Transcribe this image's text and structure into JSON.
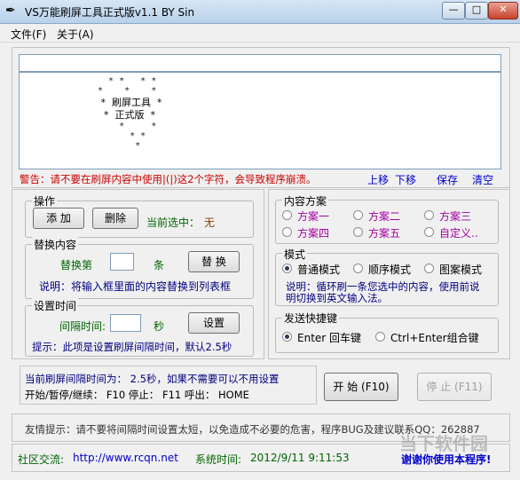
{
  "window": {
    "title": "VS万能刷屏工具正式版v1.1    BY Sin",
    "app_icon": "feather-icon",
    "min_label": "—",
    "max_label": "□",
    "close_label": "✕"
  },
  "menu": {
    "file": "文件(F)",
    "about": "关于(A)"
  },
  "preview": {
    "line1": "  * *   * *",
    "line2": "*    *    *",
    "line3": " *  刷屏工具  *",
    "line4": "  *  正式版  *",
    "line5": "    *     *",
    "line6": "      * *",
    "line7": "       *"
  },
  "warning": "警告：请不要在刷屏内容中使用|(|)这2个字符，会导致程序崩溃。",
  "actions": {
    "up": "上移",
    "down": "下移",
    "save": "保存",
    "clear": "清空"
  },
  "ops": {
    "label": "操作",
    "add": "添 加",
    "delete": "删除",
    "current_selected_label": "当前选中：",
    "current_selected_value": "无"
  },
  "replace": {
    "label": "替换内容",
    "prefix": "替换第",
    "suffix": "条",
    "button": "替 换",
    "hint": "说明：将输入框里面的内容替换到列表框"
  },
  "interval": {
    "label": "设置时间",
    "prefix": "间隔时间:",
    "unit": "秒",
    "button": "设置",
    "hint": "提示：此项是设置刷屏间隔时间，默认2.5秒"
  },
  "content_plan": {
    "label": "内容方案",
    "options": [
      "方案一",
      "方案二",
      "方案三",
      "方案四",
      "方案五",
      "自定义.."
    ]
  },
  "mode": {
    "label": "模式",
    "options": [
      "普通模式",
      "顺序模式",
      "图案模式"
    ],
    "selected": 0,
    "hint": "说明：循环刷一条您选中的内容，使用前说明切换到英文输入法。"
  },
  "hotkey": {
    "label": "发送快捷键",
    "options": [
      "Enter 回车键",
      "Ctrl+Enter组合键"
    ],
    "selected": 0
  },
  "status": {
    "interval_text": "当前刷屏间隔时间为： 2.5秒，如果不需要可以不用设置",
    "keys_text": "开始/暂停/继续： F10     停止： F11     呼出： HOME"
  },
  "controls": {
    "start": "开 始 (F10)",
    "stop": "停 止 (F11)"
  },
  "tip": "友情提示：请不要将间隔时间设置太短，以免造成不必要的危害，程序BUG及建议联系QQ：262887",
  "footer": {
    "community_label": "社区交流:",
    "community_url": "http://www.rcqn.net",
    "time_label": "系统时间:",
    "time_value": "2012/9/11 9:11:53",
    "thanks": "谢谢你使用本程序!"
  },
  "watermark": "当下软件园"
}
